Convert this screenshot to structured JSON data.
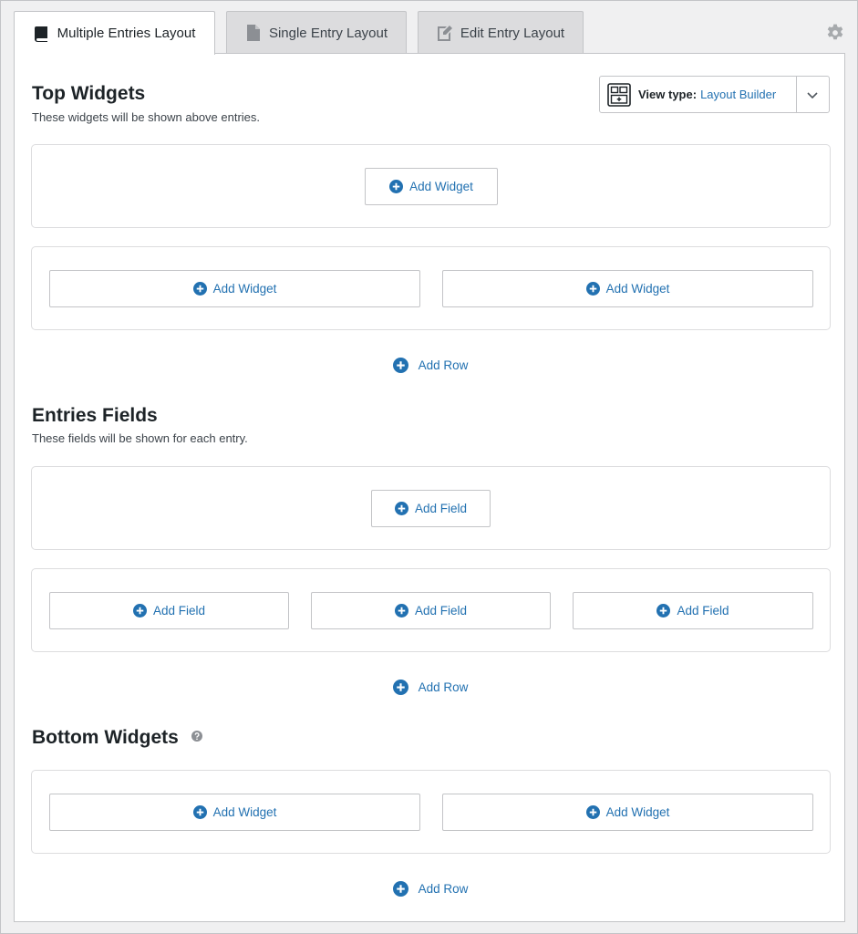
{
  "tabs": [
    {
      "label": "Multiple Entries Layout",
      "icon": "book-icon",
      "active": true
    },
    {
      "label": "Single Entry Layout",
      "icon": "document-icon",
      "active": false
    },
    {
      "label": "Edit Entry Layout",
      "icon": "edit-document-icon",
      "active": false
    }
  ],
  "settings_icon": "gear-icon",
  "view_type": {
    "label": "View type:",
    "value": "Layout Builder"
  },
  "top_widgets": {
    "title": "Top Widgets",
    "description": "These widgets will be shown above entries.",
    "add_widget_label": "Add Widget",
    "add_row_label": "Add Row"
  },
  "entries_fields": {
    "title": "Entries Fields",
    "description": "These fields will be shown for each entry.",
    "add_field_label": "Add Field",
    "add_row_label": "Add Row"
  },
  "bottom_widgets": {
    "title": "Bottom Widgets",
    "add_widget_label": "Add Widget",
    "add_row_label": "Add Row"
  },
  "colors": {
    "accent": "#2271b1",
    "border": "#c3c4c7",
    "background": "#f0f0f1"
  }
}
